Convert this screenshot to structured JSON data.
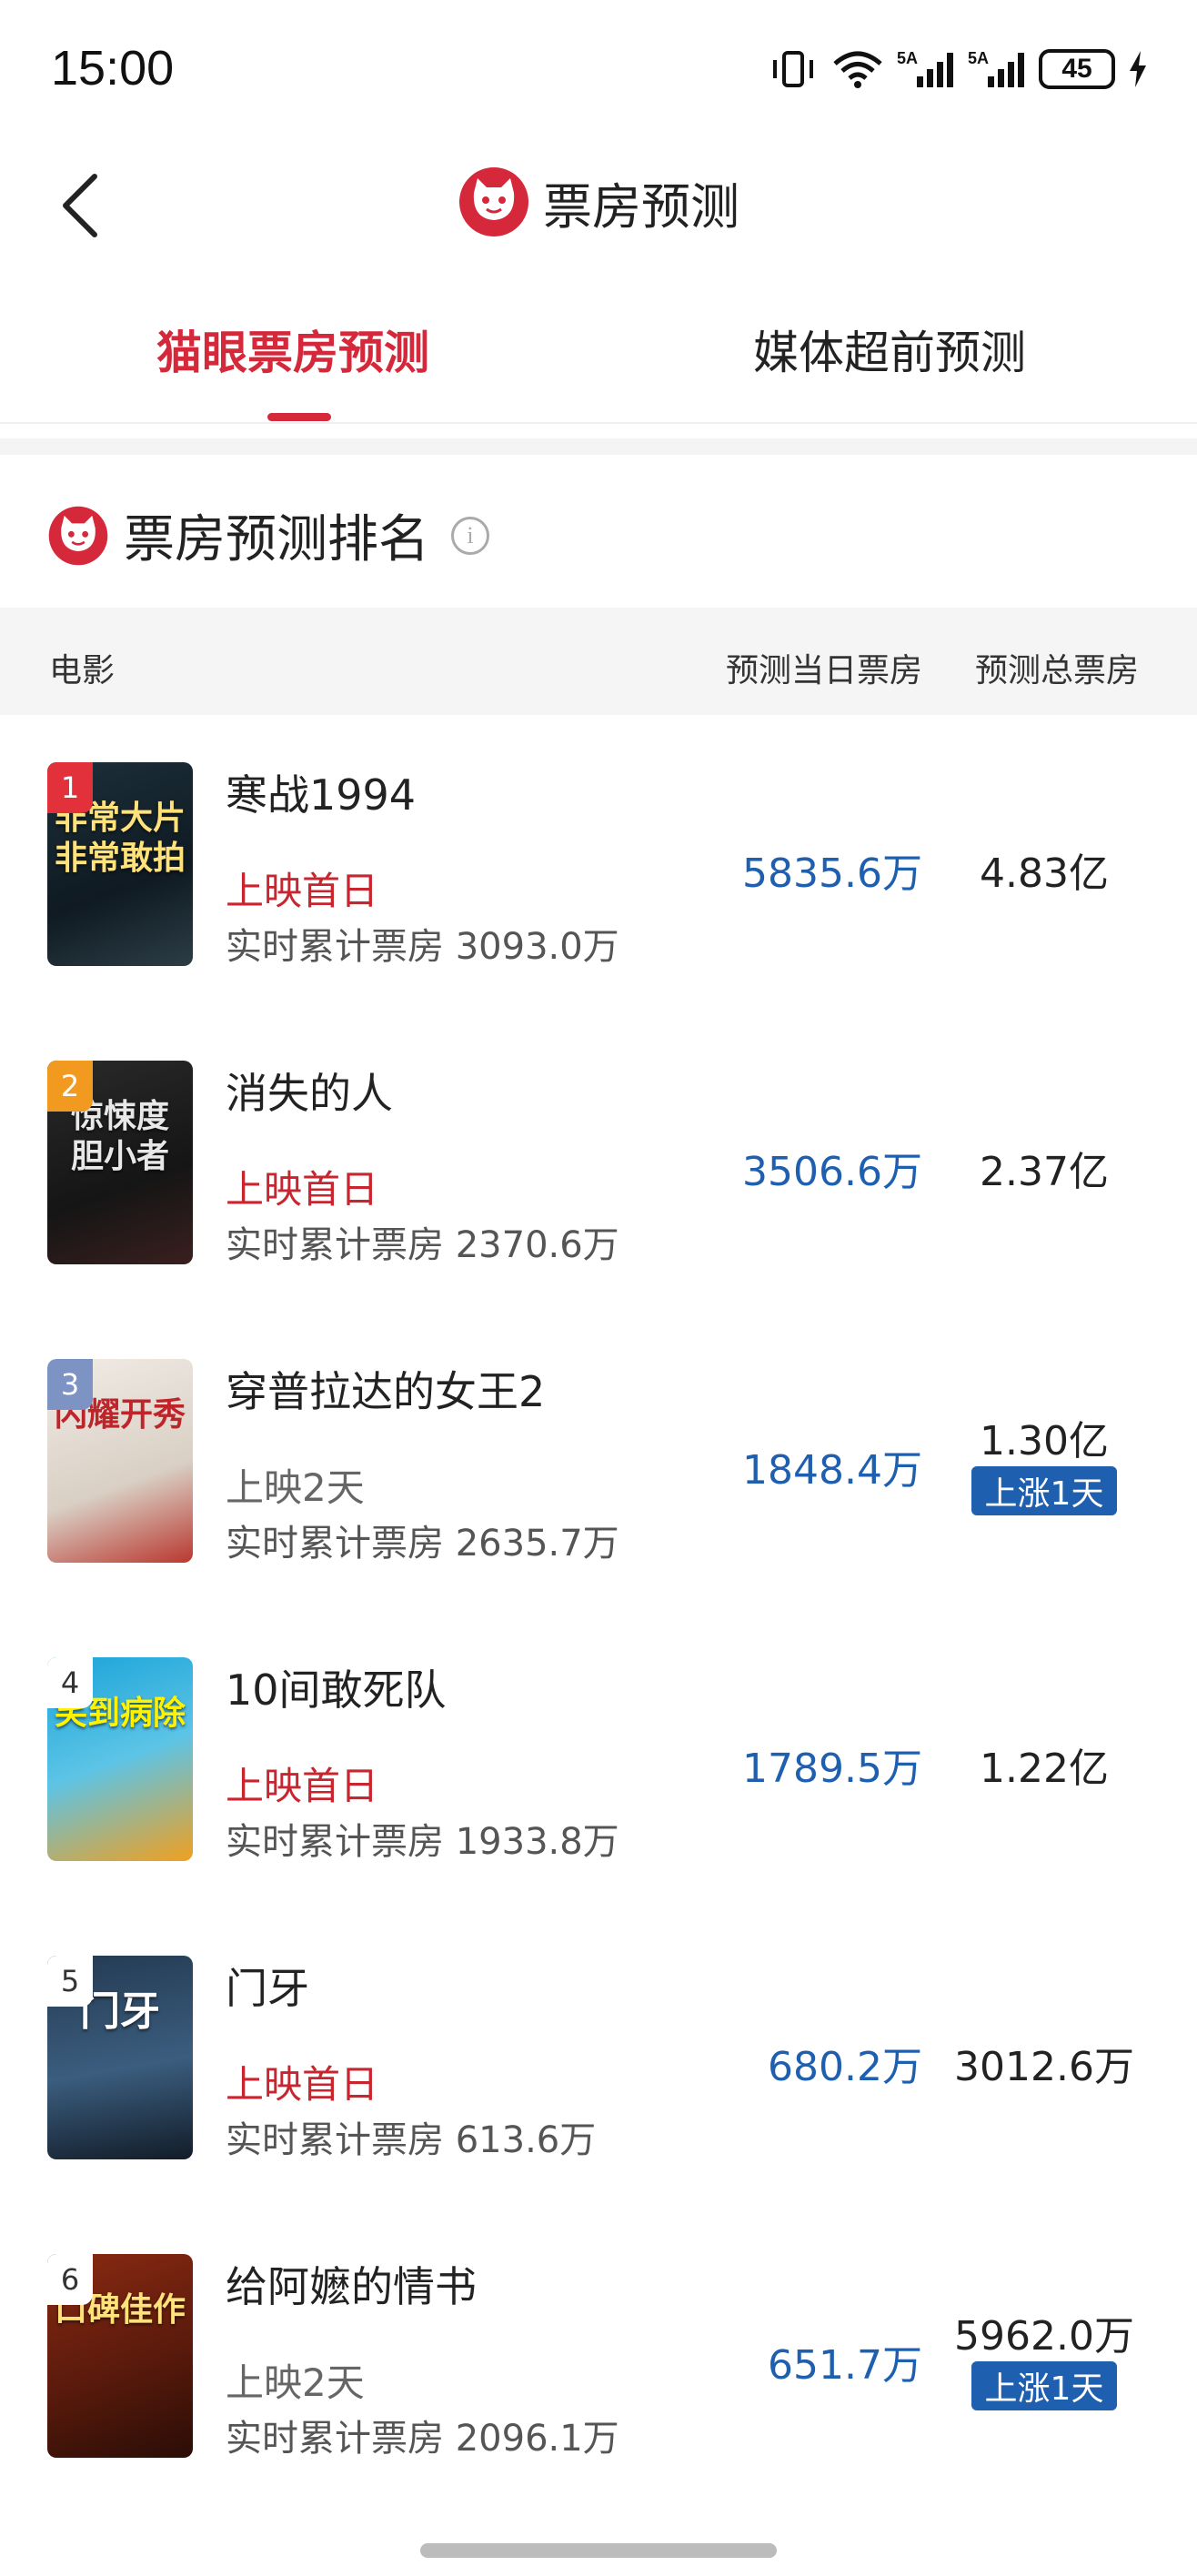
{
  "status_bar": {
    "time": "15:00",
    "battery": "45"
  },
  "header": {
    "title": "票房预测"
  },
  "tabs": [
    {
      "label": "猫眼票房预测"
    },
    {
      "label": "媒体超前预测"
    }
  ],
  "section": {
    "title": "票房预测排名"
  },
  "table": {
    "headers": {
      "movie": "电影",
      "daily": "预测当日票房",
      "total": "预测总票房"
    },
    "rows": [
      {
        "rank": "1",
        "name": "寒战1994",
        "status": "上映首日",
        "cum_label": "实时累计票房",
        "cum_value": "3093.0万",
        "daily": "5835.6万",
        "total": "4.83亿",
        "badge": "",
        "poster_text": "非常大片 非常敢拍"
      },
      {
        "rank": "2",
        "name": "消失的人",
        "status": "上映首日",
        "cum_label": "实时累计票房",
        "cum_value": "2370.6万",
        "daily": "3506.6万",
        "total": "2.37亿",
        "badge": "",
        "poster_text": "惊悚度 胆小者"
      },
      {
        "rank": "3",
        "name": "穿普拉达的女王2",
        "status": "上映2天",
        "cum_label": "实时累计票房",
        "cum_value": "2635.7万",
        "daily": "1848.4万",
        "total": "1.30亿",
        "badge": "上涨1天",
        "poster_text": "闪耀开秀"
      },
      {
        "rank": "4",
        "name": "10间敢死队",
        "status": "上映首日",
        "cum_label": "实时累计票房",
        "cum_value": "1933.8万",
        "daily": "1789.5万",
        "total": "1.22亿",
        "badge": "",
        "poster_text": "笑到病除"
      },
      {
        "rank": "5",
        "name": "门牙",
        "status": "上映首日",
        "cum_label": "实时累计票房",
        "cum_value": "613.6万",
        "daily": "680.2万",
        "total": "3012.6万",
        "badge": "",
        "poster_text": "门牙"
      },
      {
        "rank": "6",
        "name": "给阿嬷的情书",
        "status": "上映2天",
        "cum_label": "实时累计票房",
        "cum_value": "2096.1万",
        "daily": "651.7万",
        "total": "5962.0万",
        "badge": "上涨1天",
        "poster_text": "口碑佳作"
      }
    ]
  },
  "colors": {
    "accent": "#d5283a",
    "blue": "#1f5faf"
  }
}
